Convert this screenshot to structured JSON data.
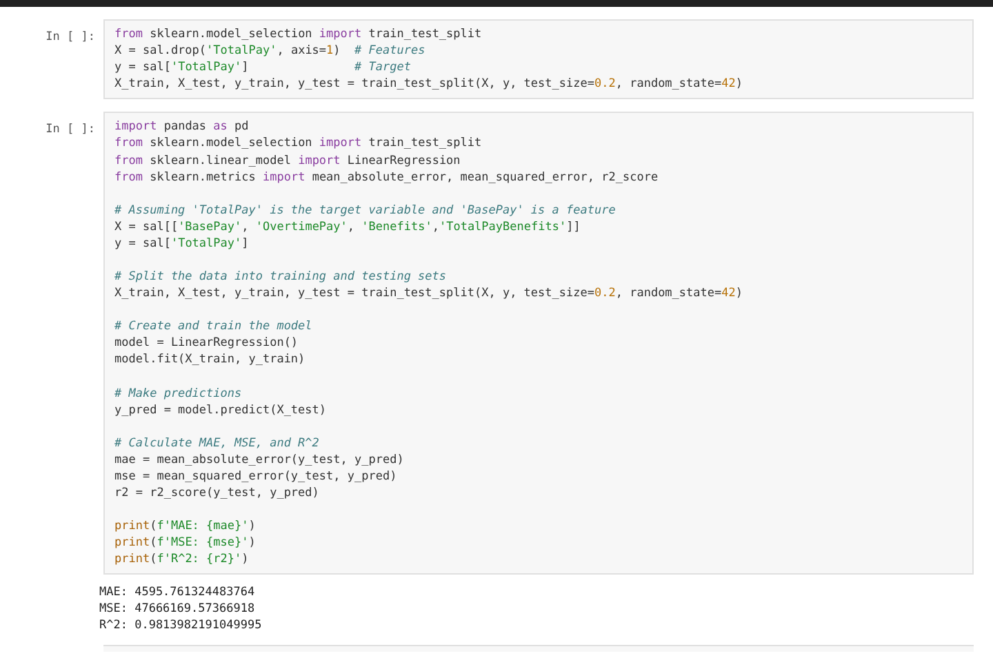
{
  "cells": [
    {
      "prompt": "In [ ]:",
      "blocks": [
        [
          [
            {
              "kind": "kw",
              "text": "from"
            },
            {
              "kind": "pl",
              "text": " sklearn.model_selection "
            },
            {
              "kind": "kw",
              "text": "import"
            },
            {
              "kind": "pl",
              "text": " train_test_split"
            }
          ],
          [
            {
              "kind": "pl",
              "text": "X = sal.drop("
            },
            {
              "kind": "str",
              "text": "'TotalPay'"
            },
            {
              "kind": "pl",
              "text": ", axis="
            },
            {
              "kind": "num",
              "text": "1"
            },
            {
              "kind": "pl",
              "text": ")  "
            },
            {
              "kind": "com",
              "text": "# Features"
            }
          ],
          [
            {
              "kind": "pl",
              "text": "y = sal["
            },
            {
              "kind": "str",
              "text": "'TotalPay'"
            },
            {
              "kind": "pl",
              "text": "]               "
            },
            {
              "kind": "com",
              "text": "# Target"
            }
          ],
          [
            {
              "kind": "pl",
              "text": "X_train, X_test, y_train, y_test = train_test_split(X, y, test_size="
            },
            {
              "kind": "num",
              "text": "0.2"
            },
            {
              "kind": "pl",
              "text": ", random_state="
            },
            {
              "kind": "num",
              "text": "42"
            },
            {
              "kind": "pl",
              "text": ")"
            }
          ]
        ]
      ]
    },
    {
      "prompt": "In [ ]:",
      "blocks": [
        [
          [
            {
              "kind": "kw",
              "text": "import"
            },
            {
              "kind": "pl",
              "text": " pandas "
            },
            {
              "kind": "kw",
              "text": "as"
            },
            {
              "kind": "pl",
              "text": " pd"
            }
          ],
          [
            {
              "kind": "kw",
              "text": "from"
            },
            {
              "kind": "pl",
              "text": " sklearn.model_selection "
            },
            {
              "kind": "kw",
              "text": "import"
            },
            {
              "kind": "pl",
              "text": " train_test_split"
            }
          ],
          [
            {
              "kind": "kw",
              "text": "from"
            },
            {
              "kind": "pl",
              "text": " sklearn.linear_model "
            },
            {
              "kind": "kw",
              "text": "import"
            },
            {
              "kind": "pl",
              "text": " LinearRegression"
            }
          ],
          [
            {
              "kind": "kw",
              "text": "from"
            },
            {
              "kind": "pl",
              "text": " sklearn.metrics "
            },
            {
              "kind": "kw",
              "text": "import"
            },
            {
              "kind": "pl",
              "text": " mean_absolute_error, mean_squared_error, r2_score"
            }
          ]
        ],
        [
          [
            {
              "kind": "com",
              "text": "# Assuming 'TotalPay' is the target variable and 'BasePay' is a feature"
            }
          ],
          [
            {
              "kind": "pl",
              "text": "X = sal[["
            },
            {
              "kind": "str",
              "text": "'BasePay'"
            },
            {
              "kind": "pl",
              "text": ", "
            },
            {
              "kind": "str",
              "text": "'OvertimePay'"
            },
            {
              "kind": "pl",
              "text": ", "
            },
            {
              "kind": "str",
              "text": "'Benefits'"
            },
            {
              "kind": "pl",
              "text": ","
            },
            {
              "kind": "str",
              "text": "'TotalPayBenefits'"
            },
            {
              "kind": "pl",
              "text": "]]"
            }
          ],
          [
            {
              "kind": "pl",
              "text": "y = sal["
            },
            {
              "kind": "str",
              "text": "'TotalPay'"
            },
            {
              "kind": "pl",
              "text": "]"
            }
          ]
        ],
        [
          [
            {
              "kind": "com",
              "text": "# Split the data into training and testing sets"
            }
          ],
          [
            {
              "kind": "pl",
              "text": "X_train, X_test, y_train, y_test = train_test_split(X, y, test_size="
            },
            {
              "kind": "num",
              "text": "0.2"
            },
            {
              "kind": "pl",
              "text": ", random_state="
            },
            {
              "kind": "num",
              "text": "42"
            },
            {
              "kind": "pl",
              "text": ")"
            }
          ]
        ],
        [
          [
            {
              "kind": "com",
              "text": "# Create and train the model"
            }
          ],
          [
            {
              "kind": "pl",
              "text": "model = LinearRegression()"
            }
          ],
          [
            {
              "kind": "pl",
              "text": "model.fit(X_train, y_train)"
            }
          ]
        ],
        [
          [
            {
              "kind": "com",
              "text": "# Make predictions"
            }
          ],
          [
            {
              "kind": "pl",
              "text": "y_pred = model.predict(X_test)"
            }
          ]
        ],
        [
          [
            {
              "kind": "com",
              "text": "# Calculate MAE, MSE, and R^2"
            }
          ],
          [
            {
              "kind": "pl",
              "text": "mae = mean_absolute_error(y_test, y_pred)"
            }
          ],
          [
            {
              "kind": "pl",
              "text": "mse = mean_squared_error(y_test, y_pred)"
            }
          ],
          [
            {
              "kind": "pl",
              "text": "r2 = r2_score(y_test, y_pred)"
            }
          ]
        ],
        [
          [
            {
              "kind": "fn",
              "text": "print"
            },
            {
              "kind": "pl",
              "text": "("
            },
            {
              "kind": "str",
              "text": "f'MAE: {mae}'"
            },
            {
              "kind": "pl",
              "text": ")"
            }
          ],
          [
            {
              "kind": "fn",
              "text": "print"
            },
            {
              "kind": "pl",
              "text": "("
            },
            {
              "kind": "str",
              "text": "f'MSE: {mse}'"
            },
            {
              "kind": "pl",
              "text": ")"
            }
          ],
          [
            {
              "kind": "fn",
              "text": "print"
            },
            {
              "kind": "pl",
              "text": "("
            },
            {
              "kind": "str",
              "text": "f'R^2: {r2}'"
            },
            {
              "kind": "pl",
              "text": ")"
            }
          ]
        ]
      ],
      "output": [
        "MAE: 4595.761324483764",
        "MSE: 47666169.57366918",
        "R^2: 0.9813982191049995"
      ]
    }
  ]
}
